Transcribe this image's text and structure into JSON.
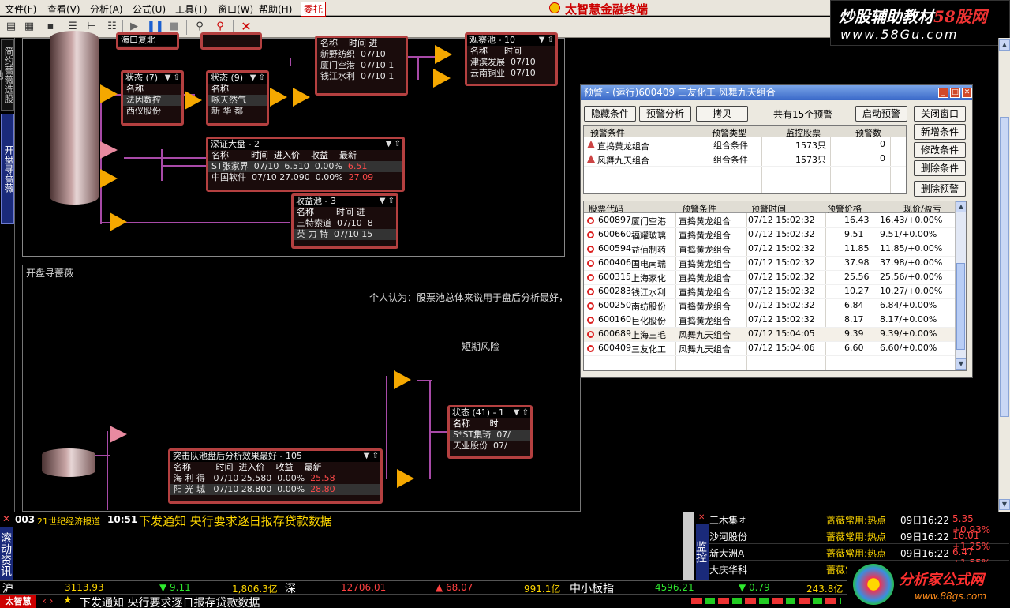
{
  "menu": {
    "items": [
      "文件(F)",
      "查看(V)",
      "分析(A)",
      "公式(U)",
      "工具(T)",
      "窗口(W)",
      "帮助(H)",
      "委托"
    ],
    "app_title": "太智慧金融终端"
  },
  "watermark": {
    "line1a": "炒股辅助教材",
    "line1b": "58股网",
    "line2": "www.58Gu.com"
  },
  "leftbar": {
    "tab1": "简约蔷薇选股池",
    "tab2": "开盘寻蔷薇"
  },
  "pane1": {
    "nodes": {
      "top_left": {
        "title": "海口复北"
      },
      "status7": {
        "title": "状态 (7)",
        "rows": [
          [
            "名称"
          ],
          [
            "法因数控"
          ],
          [
            "西仪股份"
          ]
        ]
      },
      "status9": {
        "title": "状态 (9)",
        "rows": [
          [
            "名称"
          ],
          [
            "咏天然气"
          ],
          [
            "新 华 都"
          ]
        ]
      },
      "top_mid": {
        "title": "",
        "rows": [
          [
            "名称",
            "时间",
            "进"
          ],
          [
            "新野纺织",
            "07/10",
            ""
          ],
          [
            "厦门空港",
            "07/10",
            "1"
          ],
          [
            "钱江水利",
            "07/10",
            "1"
          ]
        ]
      },
      "observe": {
        "title": "观察池 - 10",
        "rows": [
          [
            "名称",
            "时间"
          ],
          [
            "津滨发展",
            "07/10"
          ],
          [
            "云南铜业",
            "07/10"
          ]
        ]
      },
      "deep": {
        "title": "深证大盘 - 2",
        "rows": [
          [
            "名称",
            "时间",
            "进入价",
            "收益",
            "最新"
          ],
          [
            "ST张家界",
            "07/10",
            "6.510",
            "0.00%",
            "6.51"
          ],
          [
            "中国软件",
            "07/10",
            "27.090",
            "0.00%",
            "27.09"
          ]
        ]
      },
      "profit": {
        "title": "收益池 - 3",
        "rows": [
          [
            "名称",
            "时间",
            "进"
          ],
          [
            "三特索道",
            "07/10",
            "8"
          ],
          [
            "英 力 特",
            "07/10",
            "15"
          ]
        ]
      }
    }
  },
  "pane2": {
    "title": "开盘寻蔷薇",
    "note": "个人认为：股票池总体来说用于盘后分析最好，",
    "note2": "短期风险",
    "nodes": {
      "status41": {
        "title": "状态 (41) - 1",
        "rows": [
          [
            "名称",
            "时"
          ],
          [
            "S*ST集琦",
            "07/"
          ],
          [
            "天业股份",
            "07/"
          ]
        ]
      },
      "breakout": {
        "title": "突击队池盘后分析效果最好 - 105",
        "rows": [
          [
            "名称",
            "时间",
            "进入价",
            "收益",
            "最新"
          ],
          [
            "海 利 得",
            "07/10",
            "25.580",
            "0.00%",
            "25.58"
          ],
          [
            "阳 光 城",
            "07/10",
            "28.800",
            "0.00%",
            "28.80"
          ]
        ]
      }
    }
  },
  "dialog": {
    "title": "预警 - (运行)600409 三友化工 风舞九天组合",
    "buttons": {
      "hide": "隐藏条件",
      "analysis": "预警分析",
      "copy": "拷贝",
      "start": "启动预警",
      "close": "关闭窗口",
      "add": "新增条件",
      "modify": "修改条件",
      "delete_cond": "删除条件",
      "delete_alert": "删除预警"
    },
    "count_text": "共有15个预警",
    "cond_headers": [
      "预警条件",
      "预警类型",
      "监控股票",
      "预警数"
    ],
    "conditions": [
      [
        "直捣黄龙组合",
        "组合条件",
        "1573只",
        "0"
      ],
      [
        "风舞九天组合",
        "组合条件",
        "1573只",
        "0"
      ]
    ],
    "alert_headers": [
      "股票代码",
      "预警条件",
      "预警时间",
      "预警价格",
      "现价/盈亏"
    ],
    "alerts": [
      [
        "600897",
        "厦门空港",
        "直捣黄龙组合",
        "07/12 15:02:32",
        "16.43",
        "16.43/+0.00%"
      ],
      [
        "600660",
        "福耀玻璃",
        "直捣黄龙组合",
        "07/12 15:02:32",
        "9.51",
        "9.51/+0.00%"
      ],
      [
        "600594",
        "益佰制药",
        "直捣黄龙组合",
        "07/12 15:02:32",
        "11.85",
        "11.85/+0.00%"
      ],
      [
        "600406",
        "国电南瑞",
        "直捣黄龙组合",
        "07/12 15:02:32",
        "37.98",
        "37.98/+0.00%"
      ],
      [
        "600315",
        "上海家化",
        "直捣黄龙组合",
        "07/12 15:02:32",
        "25.56",
        "25.56/+0.00%"
      ],
      [
        "600283",
        "钱江水利",
        "直捣黄龙组合",
        "07/12 15:02:32",
        "10.27",
        "10.27/+0.00%"
      ],
      [
        "600250",
        "南纺股份",
        "直捣黄龙组合",
        "07/12 15:02:32",
        "6.84",
        "6.84/+0.00%"
      ],
      [
        "600160",
        "巨化股份",
        "直捣黄龙组合",
        "07/12 15:02:32",
        "8.17",
        "8.17/+0.00%"
      ],
      [
        "600689",
        "上海三毛",
        "风舞九天组合",
        "07/12 15:04:05",
        "9.39",
        "9.39/+0.00%"
      ],
      [
        "600409",
        "三友化工",
        "风舞九天组合",
        "07/12 15:04:06",
        "6.60",
        "6.60/+0.00%"
      ]
    ]
  },
  "news": {
    "code": "003",
    "source": "21世纪经济报道",
    "time": "10:51",
    "headline": "下发通知 央行要求逐日报存贷款数据",
    "side_label": "滚动资讯"
  },
  "monitor": {
    "label": "监控",
    "rows": [
      [
        "三木集团",
        "",
        "",
        ""
      ],
      [
        "沙河股份",
        "蔷薇常用:热点",
        "09日16:22",
        "16.01 +1.25%"
      ],
      [
        "新大洲A",
        "蔷薇常用:热点",
        "09日16:22",
        "6.47 +1.55%"
      ],
      [
        "大庆华科",
        "蔷薇常",
        "",
        ""
      ]
    ],
    "first_row_tag": "蔷薇常用:热点",
    "first_row_time": "09日16:22",
    "first_row_val": "5.35 +0.93%"
  },
  "index": {
    "sh_label": "沪",
    "sh_value": "3113.93",
    "sh_change": "▼ 9.11",
    "sh_amount": "1,806.3亿",
    "sz_label": "深",
    "sz_value": "12706.01",
    "sz_change": "▲ 68.07",
    "sz_amount": "991.1亿",
    "mid_label": "中小板指",
    "mid_value": "4596.21",
    "mid_change": "▼ 0.79",
    "mid_amount": "243.8亿"
  },
  "status": {
    "brand": "太智慧",
    "ticker": "下发通知 央行要求逐日报存贷款数据"
  },
  "logo2": {
    "text": "分析家公式网",
    "url": "www.88gs.com"
  }
}
